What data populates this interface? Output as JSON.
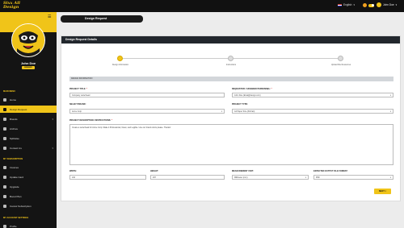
{
  "app": {
    "logo_text": "Sixx All Designs"
  },
  "topbar": {
    "language": "English",
    "user_name": "John Doe",
    "chev": "▾"
  },
  "sidebar": {
    "profile_name": "John Doe",
    "profile_badge": "MEMBER SINCE",
    "menu_header": "MAIN MENU",
    "items": [
      {
        "label": "Home",
        "icon": "home-icon"
      },
      {
        "label": "Design Request",
        "icon": "request-icon",
        "active": true
      },
      {
        "label": "Brands",
        "icon": "brand-icon"
      },
      {
        "label": "Archive",
        "icon": "archive-icon"
      },
      {
        "label": "Splitwise",
        "icon": "split-icon"
      },
      {
        "label": "Contact Us",
        "icon": "contact-icon"
      }
    ],
    "subscription_header": "MY SUBSCRIPTION",
    "sub_items": [
      {
        "label": "Invoices",
        "icon": "invoice-icon"
      },
      {
        "label": "Update Card",
        "icon": "card-icon"
      },
      {
        "label": "Upgrade",
        "icon": "upgrade-icon"
      },
      {
        "label": "Boost Plan",
        "icon": "boost-icon"
      },
      {
        "label": "Cancel Subscription",
        "icon": "cancel-icon"
      }
    ],
    "account_header": "MY ACCOUNT SETTINGS",
    "account_items": [
      {
        "label": "Profile",
        "icon": "profile-icon"
      }
    ]
  },
  "page": {
    "title": "Design Request"
  },
  "panel": {
    "title": "Design Request Details",
    "steps": [
      {
        "label": "Design Information"
      },
      {
        "label": "Instructions"
      },
      {
        "label": "Upload File Resources"
      }
    ],
    "section_label": "DESIGN INFORMATION",
    "fields": {
      "project_title": {
        "label": "PROJECT TITLE:",
        "value": "Company Letterhead"
      },
      "requestor": {
        "label": "REQUESTOR / ASSIGNED PERSONNEL:",
        "value": "John Doe (Emai@design.com)"
      },
      "brand": {
        "label": "SELECT BRAND:",
        "value": "Acme Corp"
      },
      "project_type": {
        "label": "PROJECT TYPE:",
        "value": "A4 Paper Size (Portrait)"
      },
      "description": {
        "label": "PROJECT DESCRIPTION / INSTRUCTIONS:",
        "value": "Create a Letterhead for Acme Corp. Make it Professional, Clean, and Legible. Use our brand colors please. Thanks!"
      },
      "width": {
        "label": "WIDTH:",
        "value": "210"
      },
      "height": {
        "label": "HEIGHT:",
        "value": "297"
      },
      "unit": {
        "label": "MEASUREMENT UNIT:",
        "value": "Millimeter (mm)"
      },
      "format": {
        "label": "EXPECTED OUTPUT FILE FORMAT:",
        "value": "PDF"
      }
    },
    "required_mark": "*",
    "next_label": "NEXT >"
  }
}
